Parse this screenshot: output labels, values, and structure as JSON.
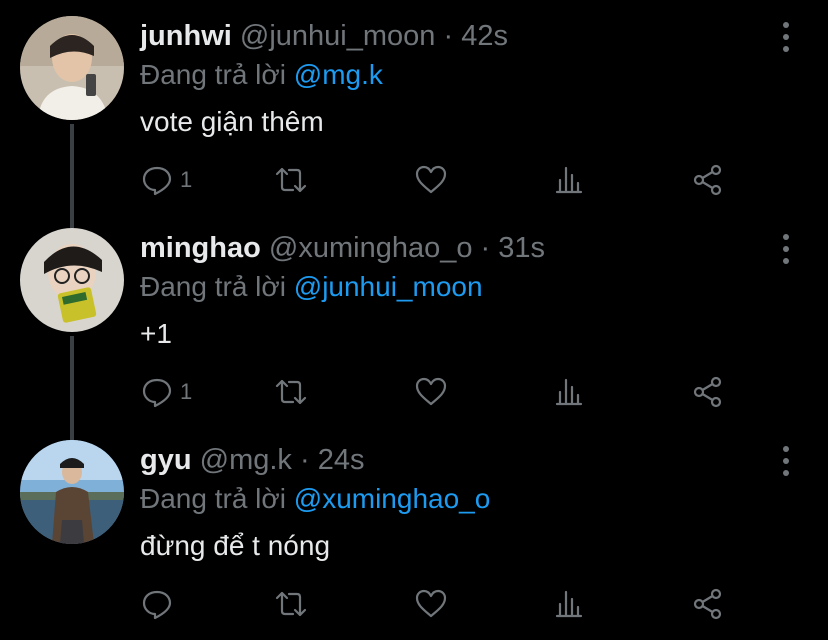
{
  "tweets": [
    {
      "display_name": "junhwi",
      "handle": "@junhui_moon",
      "separator": "·",
      "time": "42s",
      "reply_prefix": "Đang trả lời",
      "reply_to": "@mg.k",
      "text": "vote giận thêm",
      "reply_count": "1",
      "avatar_icon": "avatar-photo"
    },
    {
      "display_name": "minghao",
      "handle": "@xuminghao_o",
      "separator": "·",
      "time": "31s",
      "reply_prefix": "Đang trả lời",
      "reply_to": "@junhui_moon",
      "text": "+1",
      "reply_count": "1",
      "avatar_icon": "avatar-photo"
    },
    {
      "display_name": "gyu",
      "handle": "@mg.k",
      "separator": "·",
      "time": "24s",
      "reply_prefix": "Đang trả lời",
      "reply_to": "@xuminghao_o",
      "text": "đừng để t nóng",
      "reply_count": "",
      "avatar_icon": "avatar-photo"
    }
  ],
  "colors": {
    "background": "#000000",
    "text": "#e7e9ea",
    "muted": "#71767b",
    "mention": "#1d9bf0",
    "thread_line": "#3a3f44"
  },
  "icons": {
    "reply": "reply-icon",
    "retweet": "retweet-icon",
    "like": "like-icon",
    "stats": "stats-icon",
    "share": "share-icon",
    "more": "more-icon"
  }
}
